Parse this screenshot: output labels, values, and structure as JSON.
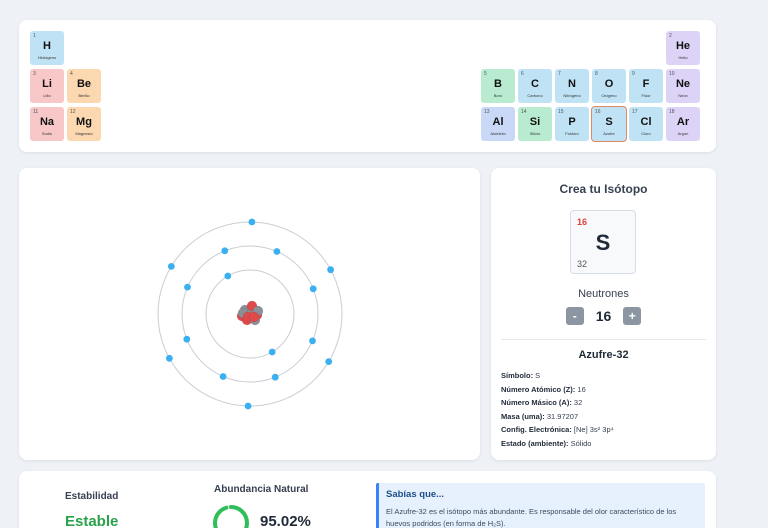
{
  "periodic_table": {
    "cells": [
      {
        "num": "1",
        "sym": "H",
        "name": "Hidrógeno",
        "color": "#bfe3f5",
        "selected": false
      },
      {
        "num": "2",
        "sym": "He",
        "name": "Helio",
        "color": "#ddd3f7",
        "selected": false
      },
      {
        "num": "3",
        "sym": "Li",
        "name": "Litio",
        "color": "#f8c8c8",
        "selected": false
      },
      {
        "num": "4",
        "sym": "Be",
        "name": "Berilio",
        "color": "#fbd8b0",
        "selected": false
      },
      {
        "num": "5",
        "sym": "B",
        "name": "Boro",
        "color": "#b9ebd0",
        "selected": false
      },
      {
        "num": "6",
        "sym": "C",
        "name": "Carbono",
        "color": "#bfe3f5",
        "selected": false
      },
      {
        "num": "7",
        "sym": "N",
        "name": "Nitrógeno",
        "color": "#bfe3f5",
        "selected": false
      },
      {
        "num": "8",
        "sym": "O",
        "name": "Oxígeno",
        "color": "#bfe3f5",
        "selected": false
      },
      {
        "num": "9",
        "sym": "F",
        "name": "Flúor",
        "color": "#bfe3f5",
        "selected": false
      },
      {
        "num": "10",
        "sym": "Ne",
        "name": "Neón",
        "color": "#ddd3f7",
        "selected": false
      },
      {
        "num": "11",
        "sym": "Na",
        "name": "Sodio",
        "color": "#f8c8c8",
        "selected": false
      },
      {
        "num": "12",
        "sym": "Mg",
        "name": "Magnesio",
        "color": "#fbd8b0",
        "selected": false
      },
      {
        "num": "13",
        "sym": "Al",
        "name": "Aluminio",
        "color": "#c9d8f7",
        "selected": false
      },
      {
        "num": "14",
        "sym": "Si",
        "name": "Silicio",
        "color": "#b9ebd0",
        "selected": false
      },
      {
        "num": "15",
        "sym": "P",
        "name": "Fósforo",
        "color": "#bfe3f5",
        "selected": false
      },
      {
        "num": "16",
        "sym": "S",
        "name": "Azufre",
        "color": "#bfe3f5",
        "selected": true
      },
      {
        "num": "17",
        "sym": "Cl",
        "name": "Cloro",
        "color": "#bfe3f5",
        "selected": false
      },
      {
        "num": "18",
        "sym": "Ar",
        "name": "Argón",
        "color": "#ddd3f7",
        "selected": false
      }
    ]
  },
  "atom": {
    "shell_electrons": [
      2,
      8,
      6
    ],
    "nucleus_color": "#e04a4a",
    "neutron_color": "#8b8f96",
    "electron_color": "#3bb0f0",
    "orbit_color": "#c9cdd3"
  },
  "isotope": {
    "title": "Crea tu Isótopo",
    "atomic_number": "16",
    "symbol": "S",
    "mass_number": "32",
    "neutrons_label": "Neutrones",
    "minus_label": "-",
    "plus_label": "+",
    "neutrons": "16",
    "name": "Azufre-32",
    "props": [
      {
        "label": "Símbolo:",
        "value": "S"
      },
      {
        "label": "Número Atómico (Z):",
        "value": "16"
      },
      {
        "label": "Número Másico (A):",
        "value": "32"
      },
      {
        "label": "Masa (uma):",
        "value": "31.97207"
      },
      {
        "label": "Config. Electrónica:",
        "value": "[Ne] 3s² 3p⁴"
      },
      {
        "label": "Estado (ambiente):",
        "value": "Sólido"
      }
    ]
  },
  "bottom": {
    "stability_title": "Estabilidad",
    "stability_value": "Estable",
    "stability_color": "#2aa14b",
    "abundance_title": "Abundancia Natural",
    "abundance_value": "95.02%",
    "abundance_fraction": 0.9502,
    "abundance_color": "#2fbf5a",
    "fact_title": "Sabías que...",
    "fact_text": "El Azufre-32 es el isótopo más abundante. Es responsable del olor característico de los huevos podridos (en forma de H₂S)."
  }
}
